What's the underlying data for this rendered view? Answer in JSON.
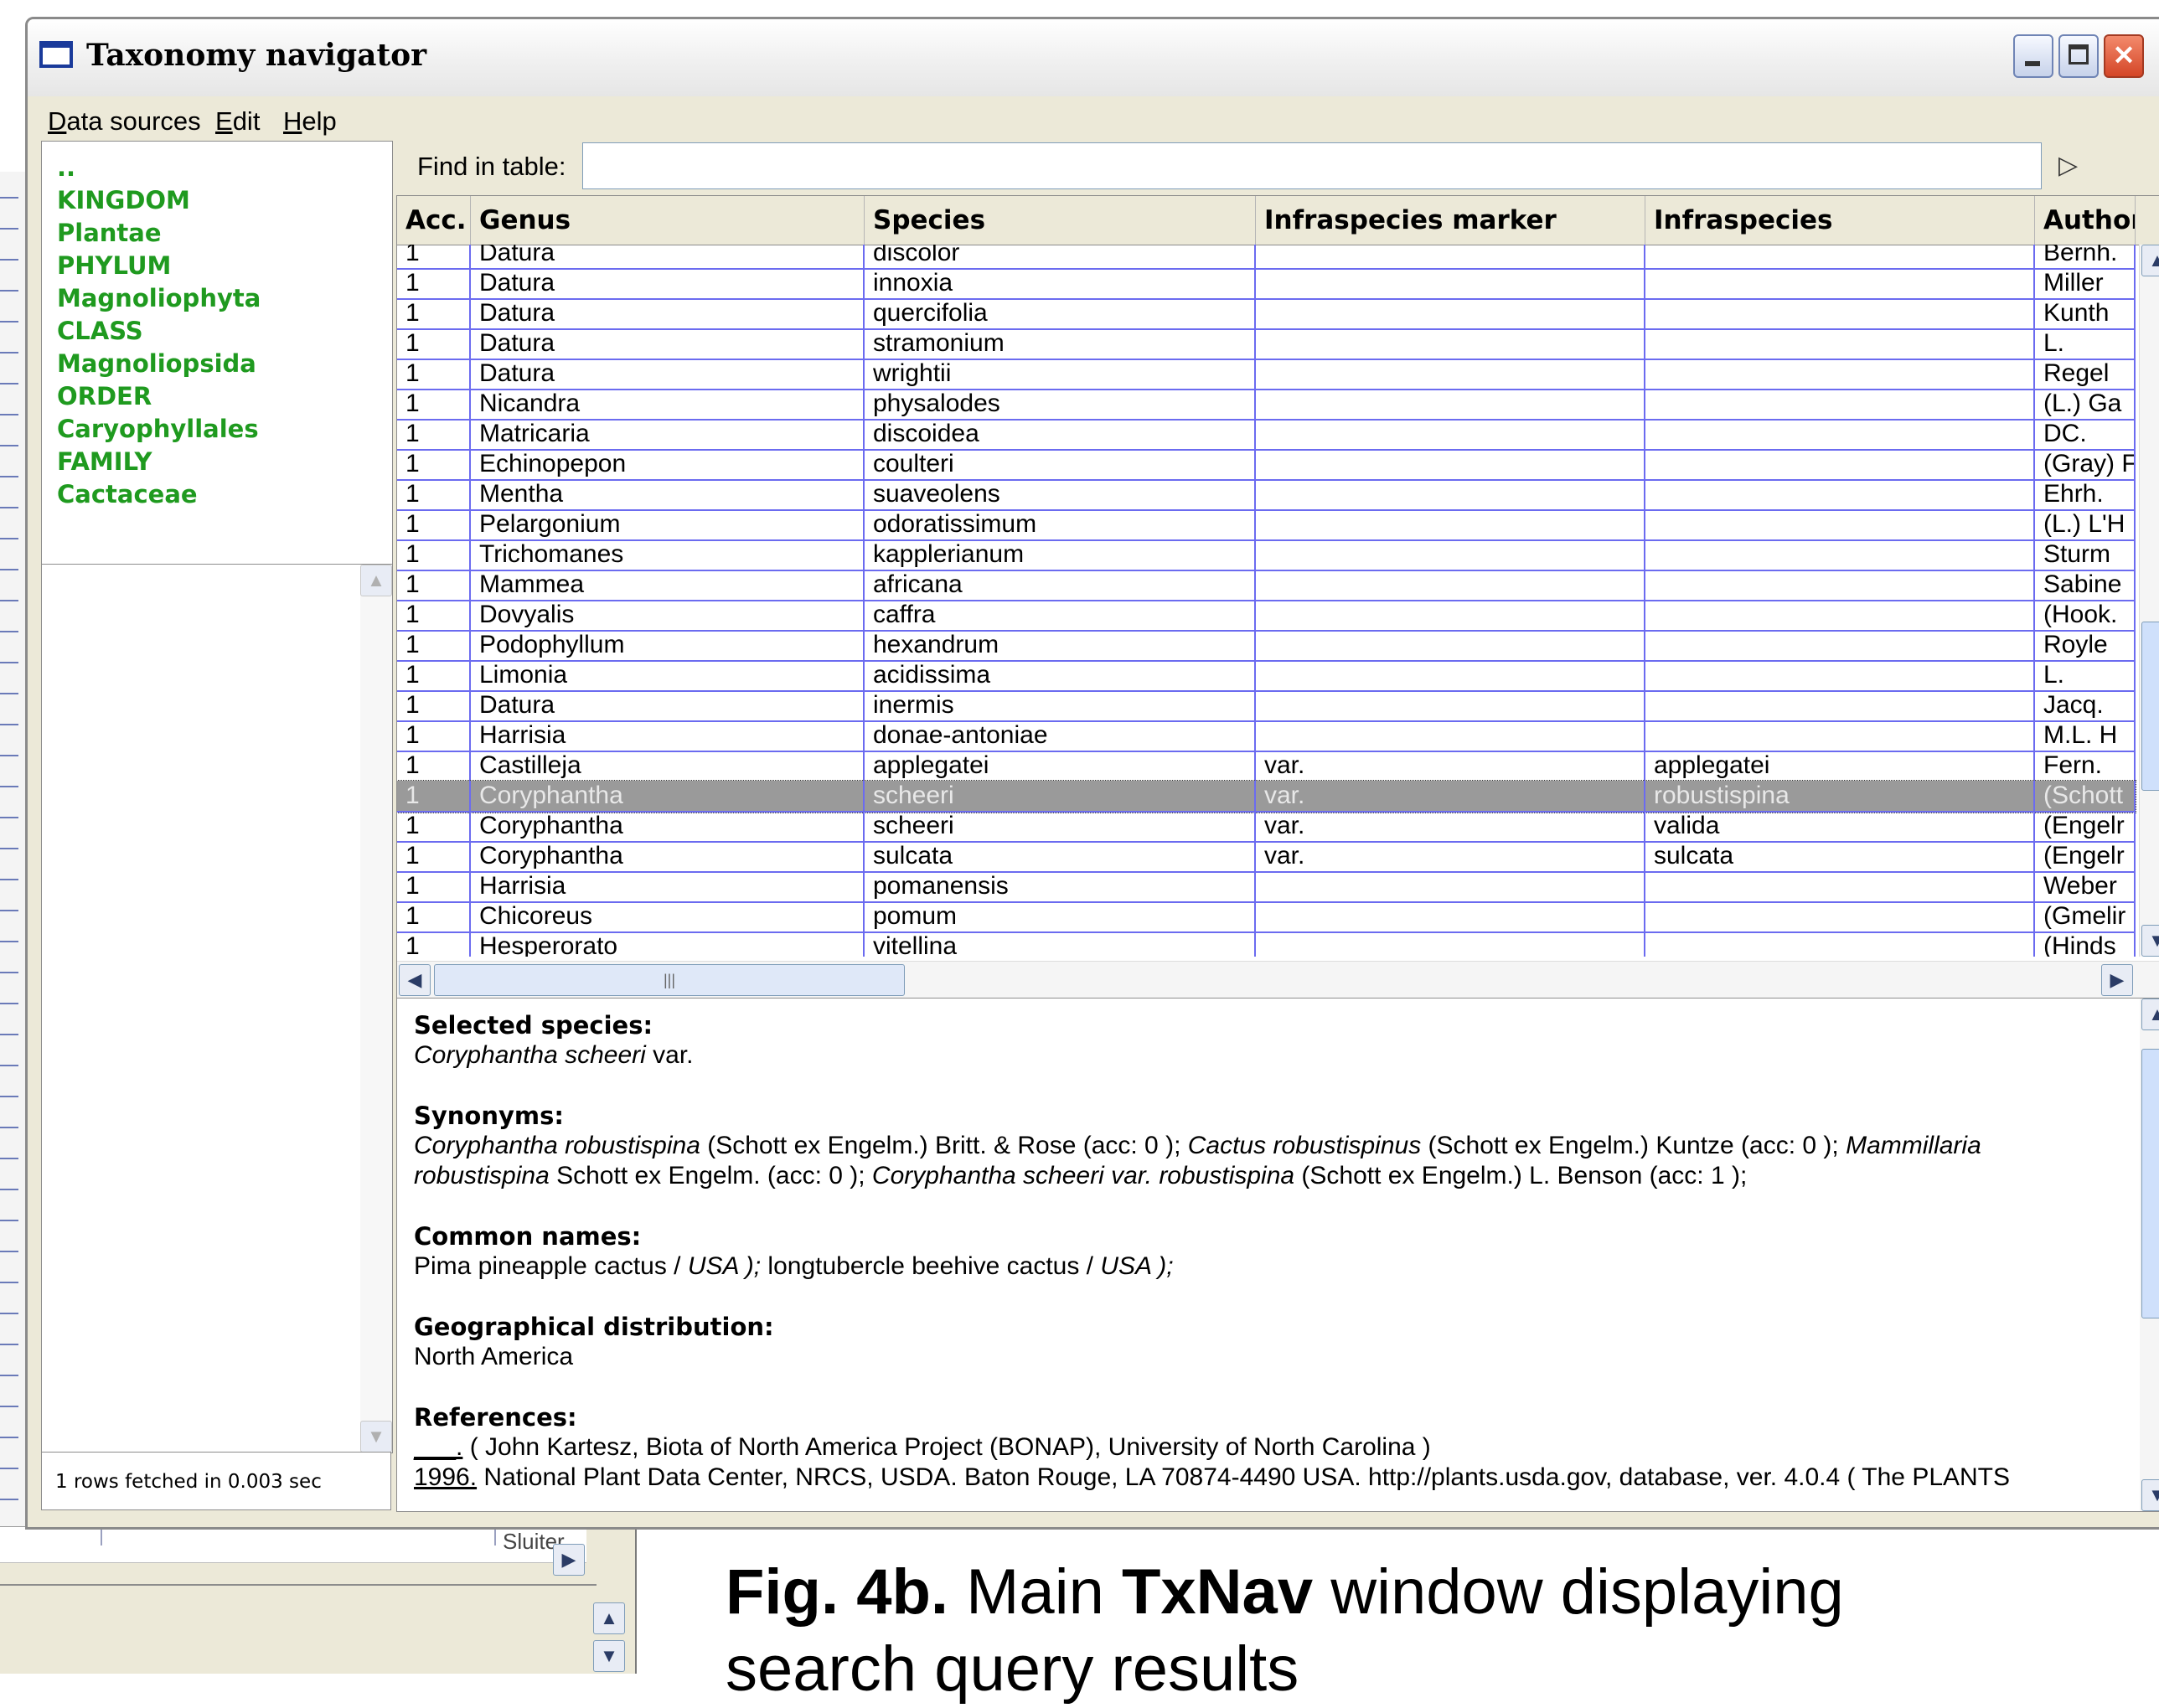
{
  "window": {
    "title": "Taxonomy navigator"
  },
  "menu": [
    {
      "accel": "D",
      "rest": "ata sources"
    },
    {
      "accel": "E",
      "rest": "dit"
    },
    {
      "accel": "H",
      "rest": "elp"
    }
  ],
  "tree": [
    "..",
    "KINGDOM",
    "Plantae",
    "PHYLUM",
    "Magnoliophyta",
    "CLASS",
    "Magnoliopsida",
    "ORDER",
    "Caryophyllales",
    "FAMILY",
    "Cactaceae"
  ],
  "status": "1 rows fetched in 0.003 sec",
  "find": {
    "label": "Find in table:",
    "value": ""
  },
  "table": {
    "columns": [
      "Acc.",
      "Genus",
      "Species",
      "Infraspecies marker",
      "Infraspecies",
      "Author"
    ],
    "rows": [
      [
        "1",
        "Datura",
        "discolor",
        "",
        "",
        "Bernh."
      ],
      [
        "1",
        "Datura",
        "innoxia",
        "",
        "",
        "Miller"
      ],
      [
        "1",
        "Datura",
        "quercifolia",
        "",
        "",
        "Kunth"
      ],
      [
        "1",
        "Datura",
        "stramonium",
        "",
        "",
        "L."
      ],
      [
        "1",
        "Datura",
        "wrightii",
        "",
        "",
        "Regel"
      ],
      [
        "1",
        "Nicandra",
        "physalodes",
        "",
        "",
        "(L.) Ga"
      ],
      [
        "1",
        "Matricaria",
        "discoidea",
        "",
        "",
        "DC."
      ],
      [
        "1",
        "Echinopepon",
        "coulteri",
        "",
        "",
        "(Gray) F"
      ],
      [
        "1",
        "Mentha",
        "suaveolens",
        "",
        "",
        "Ehrh."
      ],
      [
        "1",
        "Pelargonium",
        "odoratissimum",
        "",
        "",
        "(L.) L'H"
      ],
      [
        "1",
        "Trichomanes",
        "kapplerianum",
        "",
        "",
        "Sturm"
      ],
      [
        "1",
        "Mammea",
        "africana",
        "",
        "",
        "Sabine"
      ],
      [
        "1",
        "Dovyalis",
        "caffra",
        "",
        "",
        "(Hook."
      ],
      [
        "1",
        "Podophyllum",
        "hexandrum",
        "",
        "",
        "Royle"
      ],
      [
        "1",
        "Limonia",
        "acidissima",
        "",
        "",
        "L."
      ],
      [
        "1",
        "Datura",
        "inermis",
        "",
        "",
        "Jacq."
      ],
      [
        "1",
        "Harrisia",
        "donae-antoniae",
        "",
        "",
        "M.L. H"
      ],
      [
        "1",
        "Castilleja",
        "applegatei",
        "var.",
        "applegatei",
        "Fern."
      ],
      [
        "1",
        "Coryphantha",
        "scheeri",
        "var.",
        "robustispina",
        "(Schott"
      ],
      [
        "1",
        "Coryphantha",
        "scheeri",
        "var.",
        "valida",
        "(Engelr"
      ],
      [
        "1",
        "Coryphantha",
        "sulcata",
        "var.",
        "sulcata",
        "(Engelr"
      ],
      [
        "1",
        "Harrisia",
        "pomanensis",
        "",
        "",
        "Weber"
      ],
      [
        "1",
        "Chicoreus",
        "pomum",
        "",
        "",
        "(Gmelir"
      ],
      [
        "1",
        "Hesperorato",
        "vitellina",
        "",
        "",
        "(Hinds"
      ]
    ],
    "selected_index": 18
  },
  "details": {
    "selected_head": "Selected species:",
    "selected_name": "Coryphantha scheeri",
    "selected_suffix": " var.",
    "synonyms_head": "Synonyms:",
    "syn1_name": "Coryphantha robustispina",
    "syn1_rest": " (Schott ex Engelm.) Britt. & Rose (acc: 0 ); ",
    "syn2_name": "Cactus robustispinus",
    "syn2_rest": " (Schott ex Engelm.) Kuntze (acc: 0 ); ",
    "syn3_name": "Mammillaria",
    "syn3_name_cont": "robustispina",
    "syn3_rest": " Schott ex Engelm. (acc: 0 ); ",
    "syn4_name": "Coryphantha scheeri var. robustispina",
    "syn4_rest": " (Schott ex Engelm.) L. Benson (acc: 1 );",
    "common_head": "Common names:",
    "common1": "Pima pineapple cactus / ",
    "common1_region": "USA );",
    "common2": " longtubercle beehive cactus / ",
    "common2_region": "USA );",
    "geo_head": "Geographical distribution:",
    "geo": "North America",
    "ref_head": "References:",
    "ref1_year": "___.",
    "ref1": " ( John Kartesz, Biota of North America Project (BONAP), University of North Carolina )",
    "ref2_year": "1996.",
    "ref2": " National Plant Data Center, NRCS, USDA. Baton Rouge, LA 70874-4490 USA. http://plants.usda.gov, database, ver. 4.0.4 ( The PLANTS"
  },
  "background": {
    "partial_text": "Sluiter"
  },
  "caption": {
    "fig": "Fig. 4b.",
    "t1": " Main ",
    "app": "TxNav",
    "t2": " window displaying",
    "line2": "search query results"
  }
}
